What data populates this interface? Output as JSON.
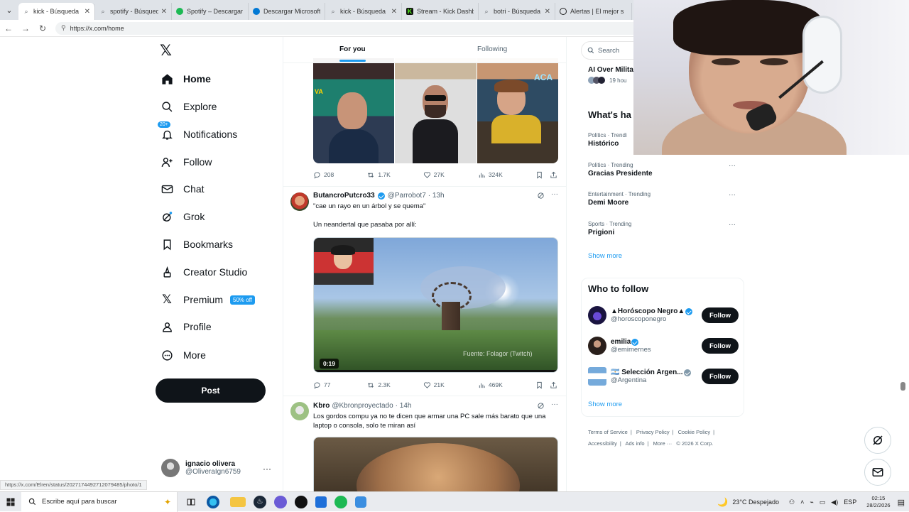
{
  "browser": {
    "tabs": [
      {
        "label": "kick - Búsqueda",
        "icon": "search-icon",
        "color": "#5f6368"
      },
      {
        "label": "spotify - Búsqueda",
        "icon": "search-icon",
        "color": "#5f6368"
      },
      {
        "label": "Spotify – Descargar",
        "icon": "spotify-icon",
        "color": "#1db954"
      },
      {
        "label": "Descargar Microsoft",
        "icon": "edge-icon",
        "color": "#0078d4"
      },
      {
        "label": "kick - Búsqueda",
        "icon": "search-icon",
        "color": "#5f6368"
      },
      {
        "label": "Stream - Kick Dashb",
        "icon": "kick-icon",
        "color": "#53fc18"
      },
      {
        "label": "botri - Búsqueda",
        "icon": "search-icon",
        "color": "#5f6368"
      },
      {
        "label": "Alertas | El mejor s",
        "icon": "tab-icon",
        "color": "#222"
      }
    ],
    "url": "https://x.com/home",
    "status_link": "https://x.com/Elren/status/2027174492712079485/photo/1"
  },
  "nav": {
    "items": [
      {
        "label": "Home",
        "icon": "home-icon"
      },
      {
        "label": "Explore",
        "icon": "search-icon"
      },
      {
        "label": "Notifications",
        "icon": "bell-icon"
      },
      {
        "label": "Follow",
        "icon": "follow-icon"
      },
      {
        "label": "Chat",
        "icon": "mail-icon"
      },
      {
        "label": "Grok",
        "icon": "grok-icon"
      },
      {
        "label": "Bookmarks",
        "icon": "bookmark-icon"
      },
      {
        "label": "Creator Studio",
        "icon": "creator-icon"
      },
      {
        "label": "Premium",
        "icon": "x-icon"
      },
      {
        "label": "Profile",
        "icon": "profile-icon"
      },
      {
        "label": "More",
        "icon": "more-icon"
      }
    ],
    "notifications_badge": "20+",
    "premium_badge": "50% off",
    "post_label": "Post",
    "user_name": "ignacio olivera",
    "user_handle": "@OliveraIgn6759",
    "user_more": "···"
  },
  "timeline": {
    "tab_for_you": "For you",
    "tab_following": "Following",
    "tweet0": {
      "replies": "208",
      "reposts": "1.7K",
      "likes": "27K",
      "views": "324K"
    },
    "tweet1": {
      "name": "ButancroPutcro33",
      "handle": "@Parrobot7",
      "time": "· 13h",
      "line1": "\"cae un rayo en un árbol y se quema\"",
      "line2": "Un neandertal que pasaba por allí:",
      "video_duration": "0:19",
      "video_caption": "Fuente: Folagor (Twitch)",
      "replies": "77",
      "reposts": "2.3K",
      "likes": "21K",
      "views": "469K"
    },
    "tweet2": {
      "name": "Kbro",
      "handle": "@Kbronproyectado",
      "time": "· 14h",
      "text": "Los gordos compu ya no te dicen que armar una PC sale más barato que una laptop o consola, solo te miran así"
    },
    "more": "···"
  },
  "right": {
    "search_placeholder": "Search",
    "top_trend": {
      "name": "AI Over Milita",
      "time": "19 hou"
    },
    "whats_happening": "What's ha",
    "trends": [
      {
        "category": "Politics · Trendi",
        "name": "Histórico"
      },
      {
        "category": "Politics · Trending",
        "name": "Gracias Presidente"
      },
      {
        "category": "Entertainment · Trending",
        "name": "Demi Moore"
      },
      {
        "category": "Sports · Trending",
        "name": "Prigioni"
      }
    ],
    "show_more": "Show more",
    "who_to_follow": "Who to follow",
    "follow_suggestions": [
      {
        "name": "▲Horóscopo Negro▲",
        "handle": "@horoscoponegro",
        "button": "Follow"
      },
      {
        "name": "emilia",
        "handle": "@emimernes",
        "button": "Follow"
      },
      {
        "name": "🇦🇷 Selección Argen...",
        "handle": "@Argentina",
        "button": "Follow"
      }
    ],
    "show_more_2": "Show more",
    "footer": [
      "Terms of Service",
      "|",
      "Privacy Policy",
      "|",
      "Cookie Policy",
      "|",
      "Accessibility",
      "|",
      "Ads info",
      "|",
      "More ···",
      "© 2026 X Corp."
    ]
  },
  "taskbar": {
    "search": "Escribe aquí para buscar",
    "weather": "23°C  Despejado",
    "lang": "ESP",
    "time": "02:15",
    "date": "28/2/2026"
  },
  "colors": {
    "accent": "#1d9bf0",
    "text": "#0f1419",
    "muted": "#536471"
  }
}
